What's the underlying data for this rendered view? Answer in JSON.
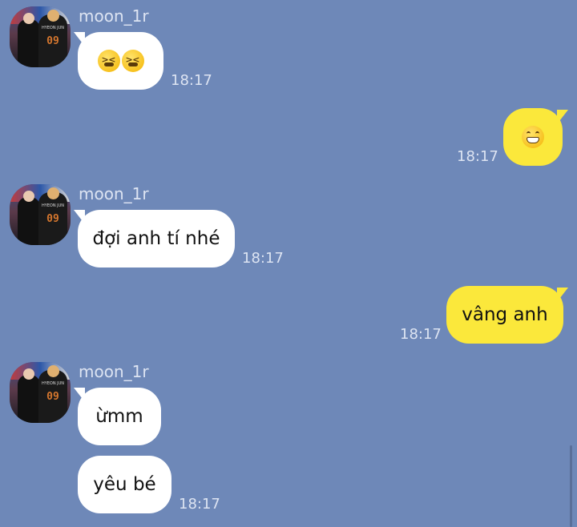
{
  "messages": [
    {
      "sender": "moon_1r",
      "text": "",
      "emoji": [
        "confounded-face",
        "confounded-face"
      ],
      "time": "18:17"
    },
    {
      "text": "",
      "emoji": [
        "grinning-face"
      ],
      "time": "18:17"
    },
    {
      "sender": "moon_1r",
      "text": "đợi anh tí nhé",
      "time": "18:17"
    },
    {
      "text": "vâng anh",
      "time": "18:17"
    },
    {
      "sender": "moon_1r",
      "text": "ừmm"
    },
    {
      "text": "yêu bé",
      "time": "18:17"
    }
  ],
  "avatar": {
    "jersey_number": "09",
    "jersey_name": "HYEON JUN"
  },
  "colors": {
    "background": "#6e88b8",
    "incoming_bubble": "#ffffff",
    "outgoing_bubble": "#fbe83b",
    "meta_text": "#dde4f2"
  }
}
